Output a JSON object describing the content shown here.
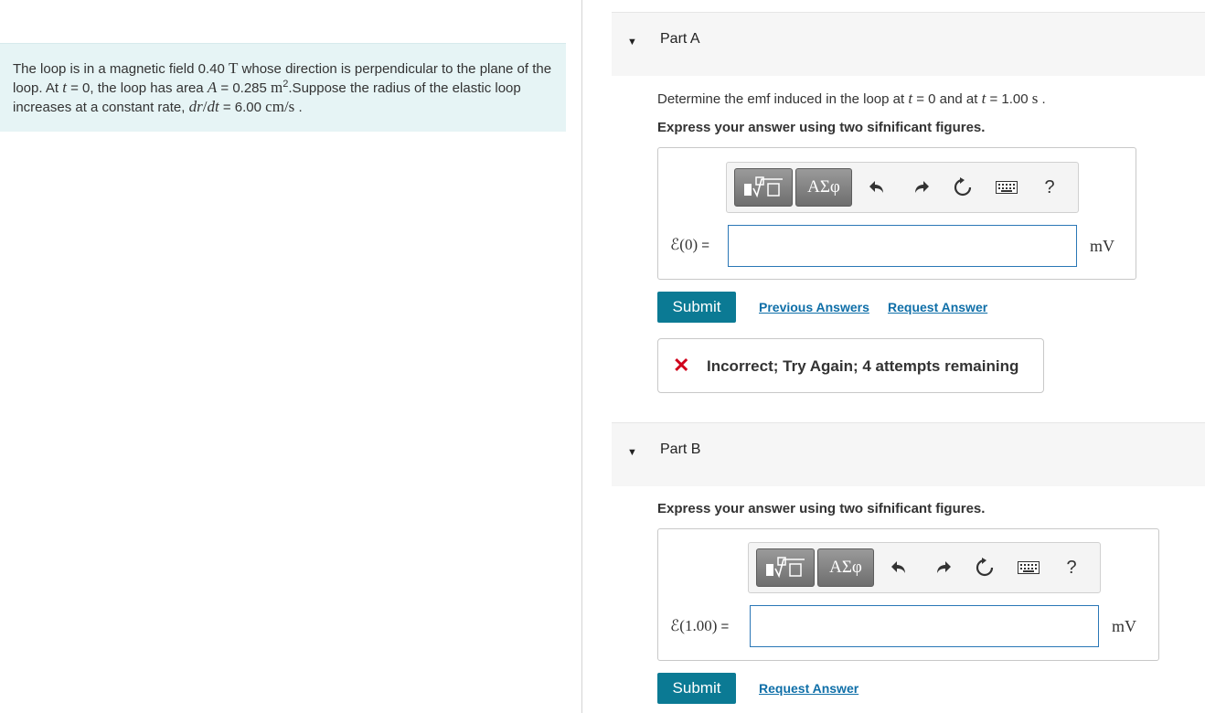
{
  "problem": {
    "seg1": "The loop is in a magnetic field 0.40 ",
    "unit_T": "T",
    "seg2": " whose direction is perpendicular to the plane of the loop. At ",
    "var_t": "t",
    "seg3": " = 0, the loop has area ",
    "var_A": "A",
    "seg4": " = 0.285 ",
    "unit_m": "m",
    "exp2": "2",
    "seg5": ".Suppose the radius of the elastic loop increases at a constant rate, ",
    "var_dr": "dr",
    "slash": "/",
    "var_dt": "dt",
    "seg6": " = 6.00 ",
    "unit_cms": "cm/s",
    "seg7": " ."
  },
  "part_a": {
    "title": "Part A",
    "q1": "Determine the emf induced in the loop at ",
    "t": "t",
    "q2": " = 0 and at ",
    "q3": " = 1.00 ",
    "s": "s",
    "q4": " .",
    "instruction": "Express your answer using two sifnificant figures.",
    "toolbar": {
      "greek": "ΑΣφ",
      "help": "?"
    },
    "label_var": "ℰ(0)",
    "label_eq": " =",
    "input_value": "",
    "unit": "mV",
    "submit": "Submit",
    "prev_answers": "Previous Answers",
    "request_answer": "Request Answer",
    "feedback": "Incorrect; Try Again; 4 attempts remaining"
  },
  "part_b": {
    "title": "Part B",
    "instruction": "Express your answer using two sifnificant figures.",
    "toolbar": {
      "greek": "ΑΣφ",
      "help": "?"
    },
    "label_var": "ℰ(1.00)",
    "label_eq": " =",
    "input_value": "",
    "unit": "mV",
    "submit": "Submit",
    "request_answer": "Request Answer"
  },
  "colors": {
    "accent": "#0b7a94",
    "link": "#0f6fa8",
    "error": "#d0021b",
    "problem_bg": "#e6f4f5"
  }
}
